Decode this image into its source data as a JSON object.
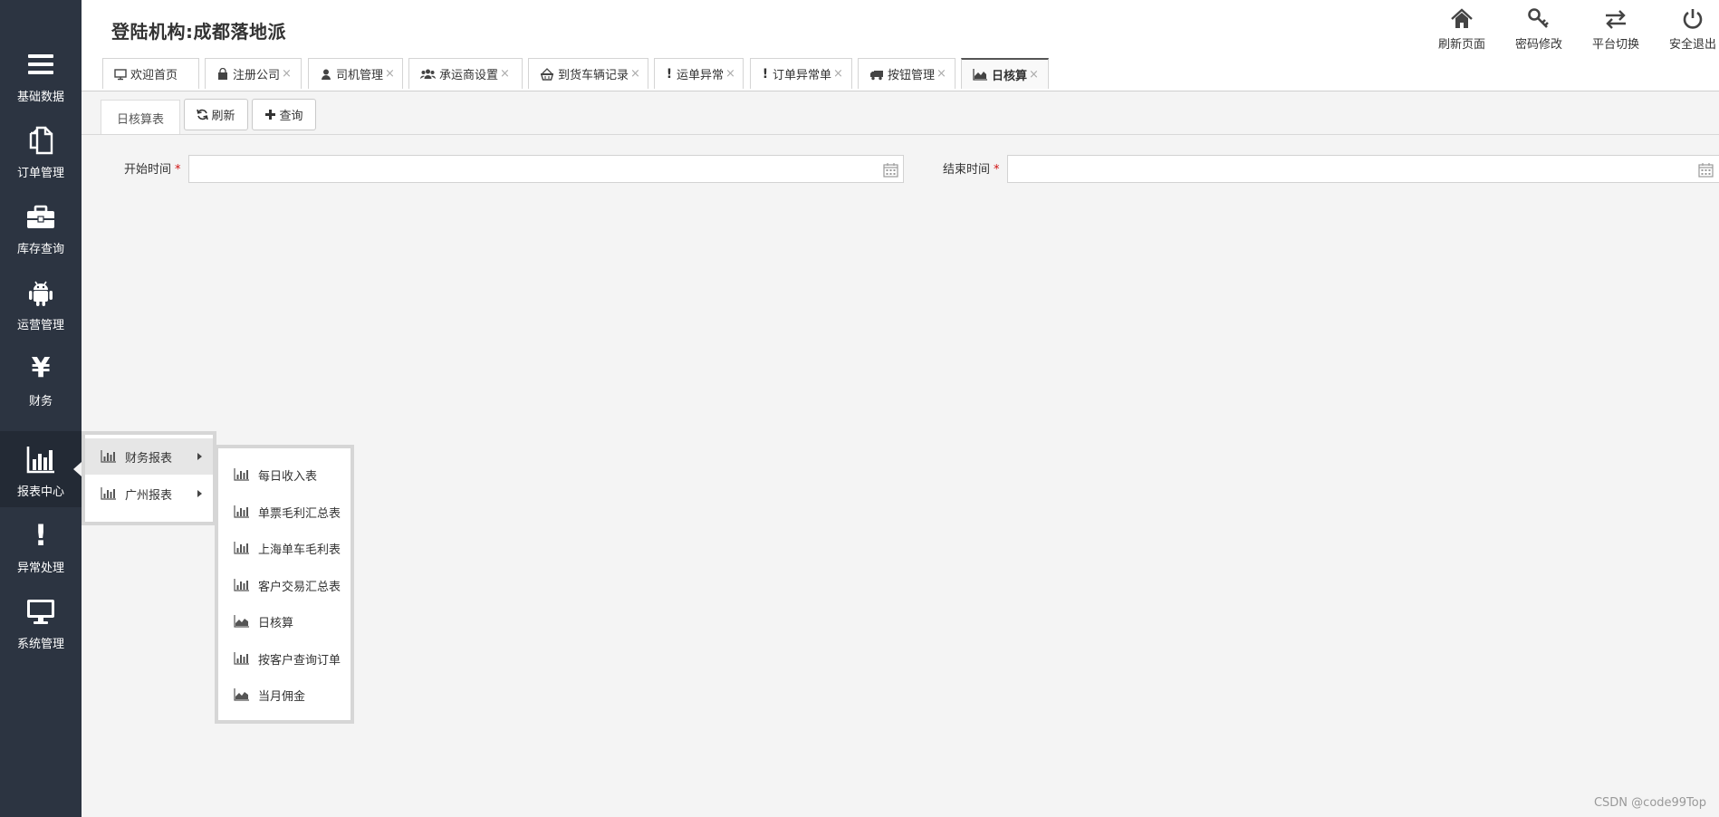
{
  "header": {
    "org_title": "登陆机构:成都落地派",
    "buttons": [
      {
        "label": "刷新页面",
        "icon": "home-icon"
      },
      {
        "label": "密码修改",
        "icon": "key-icon"
      },
      {
        "label": "平台切换",
        "icon": "exchange-icon"
      },
      {
        "label": "安全退出",
        "icon": "power-icon"
      }
    ]
  },
  "sidebar": {
    "items": [
      {
        "label": "基础数据",
        "icon": "bars-icon"
      },
      {
        "label": "订单管理",
        "icon": "copy-icon"
      },
      {
        "label": "库存查询",
        "icon": "briefcase-icon"
      },
      {
        "label": "运营管理",
        "icon": "android-icon"
      },
      {
        "label": "财务",
        "icon": "yen-icon",
        "glyph": "¥"
      },
      {
        "label": "报表中心",
        "icon": "bar-chart-icon",
        "active": true
      },
      {
        "label": "异常处理",
        "icon": "exclamation-icon",
        "glyph": "!"
      },
      {
        "label": "系统管理",
        "icon": "desktop-icon"
      }
    ]
  },
  "tabs": [
    {
      "label": "欢迎首页",
      "icon": "monitor-icon",
      "closable": false
    },
    {
      "label": "注册公司",
      "icon": "shopping-bag-icon",
      "closable": true,
      "close": "×"
    },
    {
      "label": "司机管理",
      "icon": "user-icon",
      "closable": true,
      "close": "×"
    },
    {
      "label": "承运商设置",
      "icon": "users-icon",
      "closable": true,
      "close": "×"
    },
    {
      "label": "到货车辆记录",
      "icon": "basket-icon",
      "closable": true,
      "close": "×"
    },
    {
      "label": "运单异常",
      "icon": "exclamation-icon",
      "glyph": "!",
      "closable": true,
      "close": "×"
    },
    {
      "label": "订单异常单",
      "icon": "exclamation-icon",
      "glyph": "!",
      "closable": true,
      "close": "×"
    },
    {
      "label": "按钮管理",
      "icon": "truck-icon",
      "closable": true,
      "close": "×"
    },
    {
      "label": "日核算",
      "icon": "area-chart-icon",
      "closable": true,
      "active": true,
      "close": "×"
    }
  ],
  "content": {
    "subtab_label": "日核算表",
    "refresh_label": "刷新",
    "query_label": "查询",
    "form": {
      "start_label": "开始时间",
      "end_label": "结束时间",
      "required_mark": "*",
      "start_value": "",
      "end_value": ""
    }
  },
  "menu_level1": [
    {
      "label": "财务报表",
      "icon": "bar-chart-icon",
      "hovered": true
    },
    {
      "label": "广州报表",
      "icon": "bar-chart-icon"
    }
  ],
  "menu_level2": [
    {
      "label": "每日收入表",
      "icon": "bar-chart-icon"
    },
    {
      "label": "单票毛利汇总表",
      "icon": "bar-chart-icon"
    },
    {
      "label": "上海单车毛利表",
      "icon": "bar-chart-icon"
    },
    {
      "label": "客户交易汇总表",
      "icon": "bar-chart-icon"
    },
    {
      "label": "日核算",
      "icon": "area-chart-icon"
    },
    {
      "label": "按客户查询订单",
      "icon": "bar-chart-icon"
    },
    {
      "label": "当月佣金",
      "icon": "area-chart-icon"
    }
  ],
  "watermark": "CSDN @code99Top"
}
